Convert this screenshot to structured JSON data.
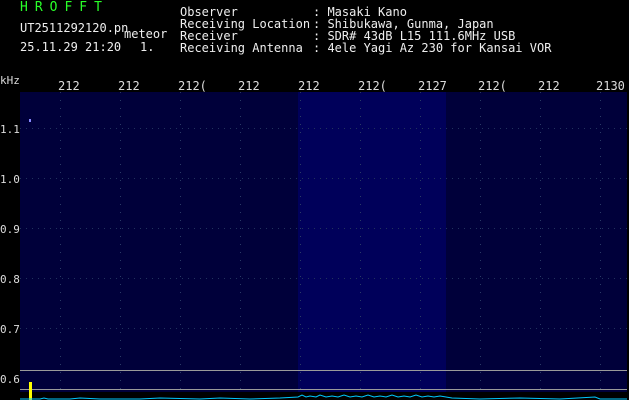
{
  "header": {
    "title": "HROFFT",
    "filename": "UT2511292120.pn",
    "mode": "meteor",
    "datetime": "25.11.29 21:20",
    "count": "1.",
    "labels": [
      "Observer",
      "Receiving Location",
      "Receiver",
      "Receiving Antenna"
    ],
    "values": [
      ": Masaki Kano",
      ": Shibukawa, Gunma, Japan",
      ": SDR# 43dB L15 111.6MHz USB",
      ": 4ele Yagi Az 230 for Kansai VOR"
    ]
  },
  "y_axis": {
    "unit": "kHz",
    "labels": [
      "1.1",
      "1.0",
      "0.9",
      "0.8",
      "0.7",
      "0.6"
    ]
  },
  "x_axis": {
    "ticks": [
      "212",
      "212",
      "212(",
      "212",
      "212",
      "212(",
      "2127",
      "212(",
      "212",
      "2130"
    ]
  },
  "colors": {
    "title": "#29ff29",
    "background": "#000000",
    "waterfall": "#00003a",
    "spectrum": "#00c8ff",
    "marker": "#ffff00"
  }
}
